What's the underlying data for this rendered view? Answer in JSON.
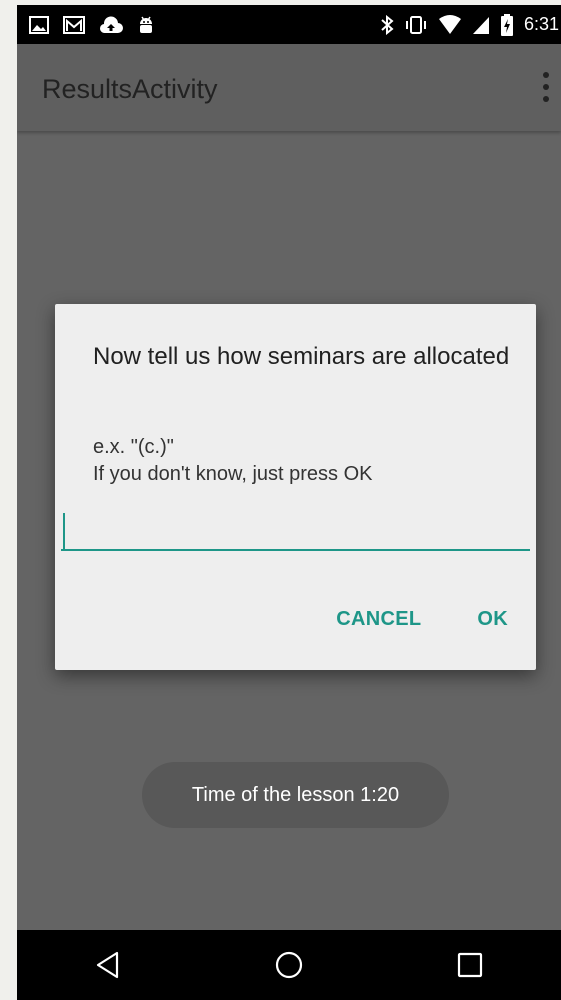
{
  "status_bar": {
    "time": "6:31",
    "left_icons": [
      "image-icon",
      "gmail-icon",
      "cloud-upload-icon",
      "android-icon"
    ],
    "right_icons": [
      "bluetooth-icon",
      "vibrate-icon",
      "wifi-icon",
      "cell-signal-icon",
      "battery-charging-icon"
    ]
  },
  "app_bar": {
    "title": "ResultsActivity",
    "menu_icon": "overflow-menu-icon"
  },
  "dialog": {
    "title": "Now tell us how seminars are allocated",
    "message": "e.x. \"(c.)\"\nIf you don't know, just press OK",
    "input_value": "",
    "cancel_label": "CANCEL",
    "ok_label": "OK",
    "accent_color": "#1e9688"
  },
  "toast": {
    "text": "Time of the lesson 1:20"
  },
  "nav_bar": {
    "buttons": [
      "back-icon",
      "home-icon",
      "recents-icon"
    ]
  }
}
